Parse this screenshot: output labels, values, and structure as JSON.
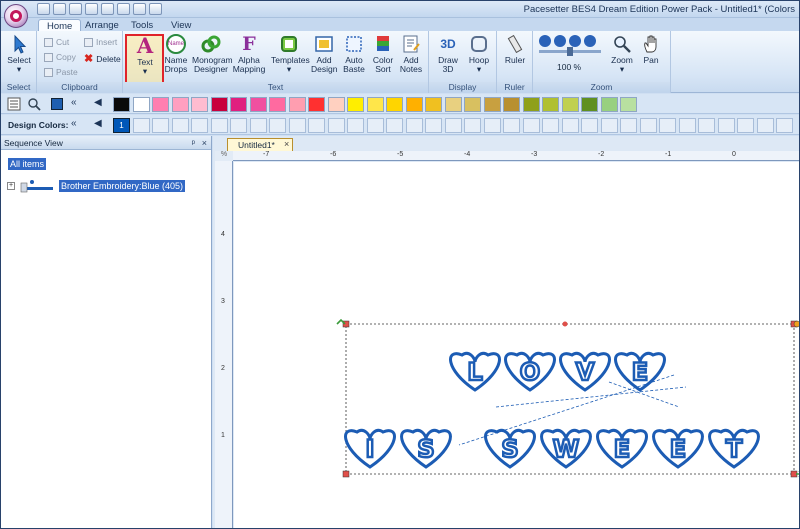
{
  "app": {
    "title": "Pacesetter BES4 Dream Edition Power Pack - Untitled1* (Colors"
  },
  "tabs": [
    {
      "label": "Home"
    },
    {
      "label": "Arrange"
    },
    {
      "label": "Tools"
    },
    {
      "label": "View"
    }
  ],
  "ribbon": {
    "select": {
      "label": "Select",
      "group": "Select"
    },
    "clipboard": {
      "cut": "Cut",
      "copy": "Copy",
      "paste": "Paste",
      "insert": "Insert",
      "delete": "Delete",
      "group": "Clipboard"
    },
    "text_group": {
      "text_btn": "Text",
      "name_drops": "Name Drops",
      "monogram": "Monogram Designer",
      "alpha": "Alpha Mapping",
      "templates": "Templates",
      "add_design": "Add Design",
      "auto_baste": "Auto Baste",
      "color_sort": "Color Sort",
      "add_notes": "Add Notes",
      "group": "Text",
      "name_icon_text": "Name",
      "alpha_glyph": "F",
      "text_glyph": "A"
    },
    "display": {
      "draw3d": "Draw 3D",
      "hoop": "Hoop",
      "group": "Display",
      "icon_3d": "3D"
    },
    "ruler": {
      "label": "Ruler",
      "group": "Ruler"
    },
    "zoom": {
      "percent": "100 %",
      "zoom": "Zoom",
      "pan": "Pan",
      "group": "Zoom"
    }
  },
  "palette": {
    "colors": [
      "#0a0a0a",
      "#ffffff",
      "#ff7fb0",
      "#ff9fc0",
      "#ffbcd0",
      "#c8003c",
      "#e0207f",
      "#f050a0",
      "#ff6aa0",
      "#ff9eb0",
      "#ff3030",
      "#ffd0c0",
      "#ffee00",
      "#ffe64a",
      "#ffd500",
      "#ffb000",
      "#f0c020",
      "#e8d080",
      "#d8c060",
      "#c8a040",
      "#b89030",
      "#8fa01a",
      "#b0c030",
      "#c0d050",
      "#609020",
      "#98d080",
      "#b8e0a0"
    ]
  },
  "design_colors": {
    "label": "Design Colors:",
    "current": "1",
    "accent": "#0057b8"
  },
  "sequence": {
    "header": "Sequence View",
    "pin": "ᵖ",
    "close": "×",
    "all_items": "All items",
    "expand": "+",
    "item_label": "Brother Embroidery:Blue (405)"
  },
  "document": {
    "tab_label": "Untitled1*",
    "close": "×",
    "corner": "%",
    "ruler_top_ticks": [
      "-7",
      "-6",
      "-5",
      "-4",
      "-3",
      "-2",
      "-1",
      "0"
    ],
    "ruler_left_ticks": [
      "4",
      "3",
      "2",
      "1"
    ],
    "design_text_line1": "LOVE",
    "design_text_line2": "IS SWEET",
    "design_color": "#1c5cb4"
  }
}
